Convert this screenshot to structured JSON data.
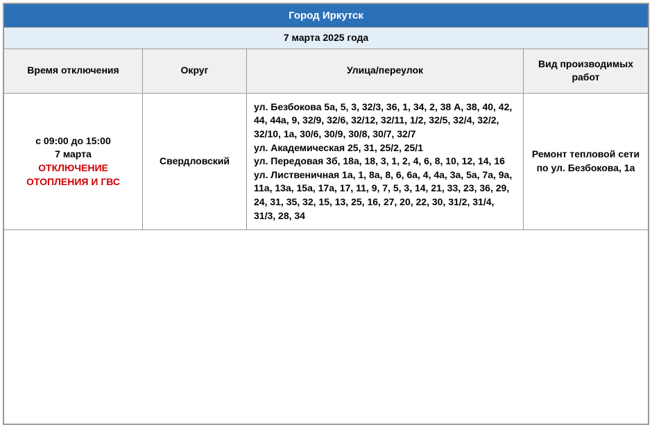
{
  "title": "Город Иркутск",
  "date": "7 марта 2025 года",
  "headers": {
    "time": "Время отключения",
    "okrug": "Округ",
    "street": "Улица/переулок",
    "work": "Вид производимых работ"
  },
  "row": {
    "time_range": "с 09:00 до 15:00",
    "time_day": "7 марта",
    "time_alert": "ОТКЛЮЧЕНИЕ ОТОПЛЕНИЯ И ГВС",
    "okrug": "Свердловский",
    "streets": {
      "l1": "ул. Безбокова 5а, 5, 3, 32/3, 36, 1, 34, 2, 38 А, 38, 40, 42, 44, 44а, 9, 32/9, 32/6, 32/12, 32/11, 1/2, 32/5, 32/4, 32/2, 32/10, 1а, 30/6, 30/9, 30/8, 30/7, 32/7",
      "l2": "ул. Академическая 25, 31, 25/2, 25/1",
      "l3": "ул. Передовая 3б, 18а, 18, 3, 1, 2, 4, 6, 8, 10, 12, 14, 16",
      "l4": "ул. Лиственичная 1а, 1, 8а, 8, 6, 6а, 4, 4а, 3а, 5а, 7а, 9а, 11а, 13а, 15а, 17а, 17, 11, 9, 7, 5, 3, 14, 21, 33, 23, 36, 29, 24, 31, 35, 32, 15, 13, 25, 16, 27, 20, 22, 30, 31/2, 31/4, 31/3, 28, 34"
    },
    "work": "Ремонт тепловой сети по ул. Безбокова, 1а"
  }
}
